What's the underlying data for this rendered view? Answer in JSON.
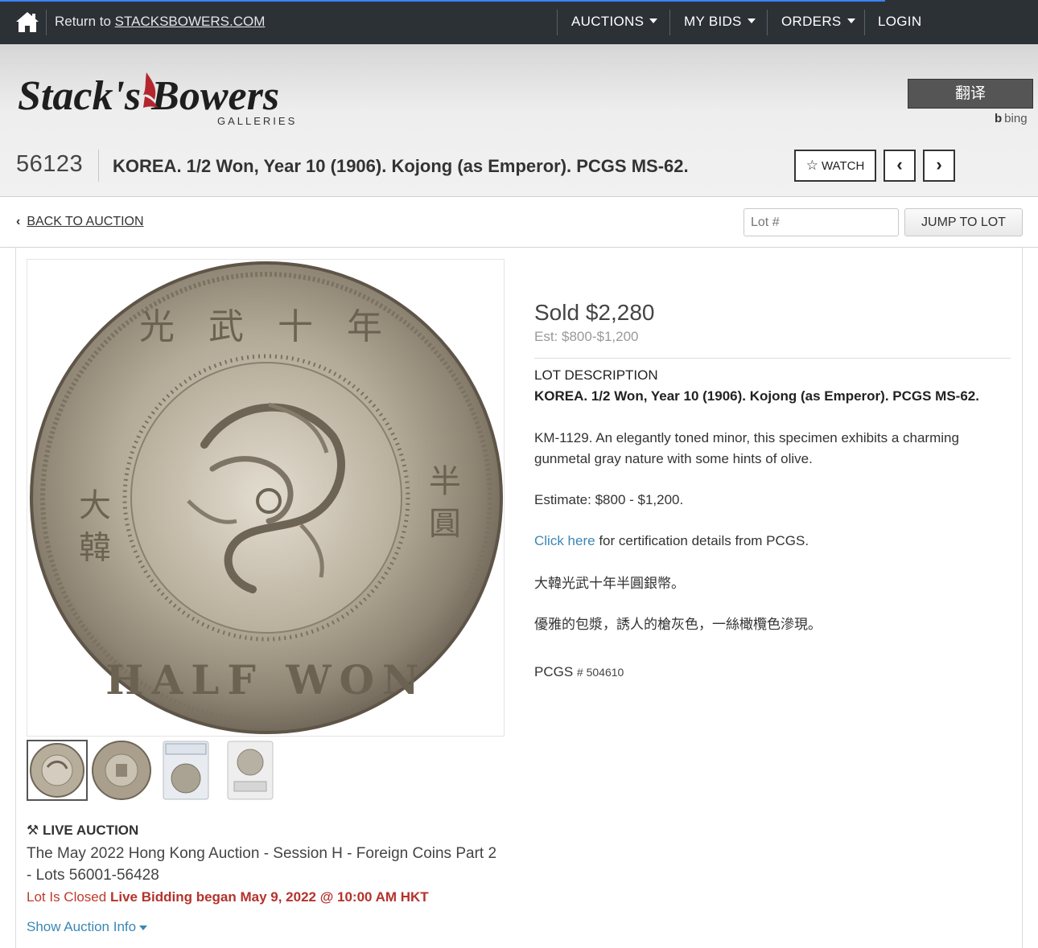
{
  "topnav": {
    "return_prefix": "Return to ",
    "return_link": "STACKSBOWERS.COM",
    "auctions": "AUCTIONS",
    "my_bids": "MY BIDS",
    "orders": "ORDERS",
    "login": "LOGIN"
  },
  "brand": {
    "logo_name": "Stack's Bowers",
    "logo_sub": "GALLERIES",
    "translate_label": "翻译",
    "bing_label": "bing"
  },
  "lot": {
    "number": "56123",
    "title": "KOREA. 1/2 Won, Year 10 (1906). Kojong (as Emperor). PCGS MS-62.",
    "watch_label": "WATCH"
  },
  "nav": {
    "back_label": "BACK TO AUCTION",
    "lot_placeholder": "Lot #",
    "jump_label": "JUMP TO LOT"
  },
  "coin": {
    "legend_top": "光 武 十 年",
    "legend_left": "大 韓",
    "legend_right": "半 圓",
    "legend_bottom": "HALF WON"
  },
  "auction": {
    "type": "LIVE AUCTION",
    "name": "The May 2022 Hong Kong Auction - Session H - Foreign Coins Part 2 - Lots 56001-56428",
    "closed": "Lot Is Closed",
    "live_began": "Live Bidding began May 9, 2022 @ 10:00 AM HKT",
    "show_info": "Show Auction Info"
  },
  "result": {
    "sold": "Sold $2,280",
    "estimate": "Est: $800-$1,200"
  },
  "description": {
    "heading": "LOT DESCRIPTION",
    "title": "KOREA. 1/2 Won, Year 10 (1906). Kojong (as Emperor). PCGS MS-62.",
    "body": "KM-1129. An elegantly toned minor, this specimen exhibits a charming gunmetal gray nature with some hints of olive.",
    "estimate_line": "Estimate: $800 - $1,200.",
    "click_here": "Click here",
    "cert_text": " for certification details from PCGS.",
    "chinese_1": "大韓光武十年半圓銀幣。",
    "chinese_2": "優雅的包漿，誘人的槍灰色，一絲橄欖色滲現。",
    "pcgs_label": "PCGS",
    "pcgs_number": "# 504610"
  }
}
